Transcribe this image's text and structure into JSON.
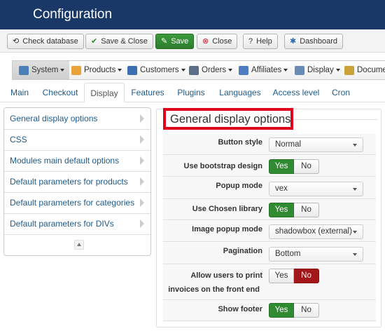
{
  "header": {
    "title": "Configuration"
  },
  "toolbar": [
    {
      "label": "Check database",
      "icon": "refresh-icon"
    },
    {
      "label": "Save & Close",
      "icon": "check-icon"
    },
    {
      "label": "Save",
      "icon": "edit-icon"
    },
    {
      "label": "Close",
      "icon": "close-circle-icon"
    },
    {
      "label": "Help",
      "icon": "question-icon"
    },
    {
      "label": "Dashboard",
      "icon": "gear-icon"
    }
  ],
  "menubar": [
    {
      "label": "System",
      "icon": "tools-icon"
    },
    {
      "label": "Products",
      "icon": "box-icon"
    },
    {
      "label": "Customers",
      "icon": "users-icon"
    },
    {
      "label": "Orders",
      "icon": "cart-icon"
    },
    {
      "label": "Affiliates",
      "icon": "affiliates-icon"
    },
    {
      "label": "Display",
      "icon": "display-icon"
    },
    {
      "label": "Docume",
      "icon": "document-icon"
    }
  ],
  "tabs": [
    "Main",
    "Checkout",
    "Display",
    "Features",
    "Plugins",
    "Languages",
    "Access level",
    "Cron"
  ],
  "sidebar": {
    "items": [
      "General display options",
      "CSS",
      "Modules main default options",
      "Default parameters for products",
      "Default parameters for categories",
      "Default parameters for DIVs"
    ]
  },
  "section": {
    "title": "General display options"
  },
  "settings": {
    "button_style": {
      "label": "Button style",
      "value": "Normal"
    },
    "bootstrap": {
      "label": "Use bootstrap design",
      "yes": "Yes",
      "no": "No",
      "selected": "Yes"
    },
    "popup_mode": {
      "label": "Popup mode",
      "value": "vex"
    },
    "chosen": {
      "label": "Use Chosen library",
      "yes": "Yes",
      "no": "No",
      "selected": "Yes"
    },
    "image_popup": {
      "label": "Image popup mode",
      "value": "shadowbox (external)"
    },
    "pagination": {
      "label": "Pagination",
      "value": "Bottom"
    },
    "print_invoices": {
      "label_line1": "Allow users to print",
      "label_line2": "invoices on the front end",
      "yes": "Yes",
      "no": "No",
      "selected": "No"
    },
    "show_footer": {
      "label": "Show footer",
      "yes": "Yes",
      "no": "No",
      "selected": "Yes"
    }
  },
  "colors": {
    "header_bg": "#1a3867",
    "save_green": "#2f8a31",
    "no_red": "#a3161a",
    "highlight_red": "#e0001b",
    "link_blue": "#1f5a8a"
  }
}
